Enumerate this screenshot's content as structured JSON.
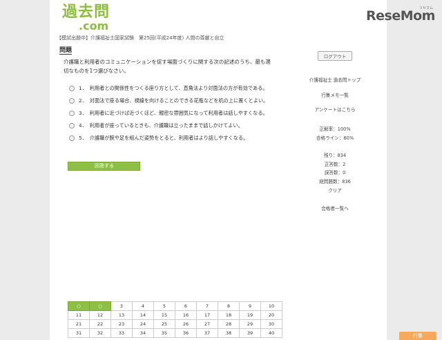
{
  "logo": {
    "main": "過去問",
    "sub": ".com"
  },
  "brand": {
    "name": "ReseMom",
    "ruby": "リセマム"
  },
  "breadcrumb": "【模試出題中】介護福祉士国家試験　第25回(平成24年度) 人間の尊厳と自立",
  "question": {
    "heading": "問題",
    "text": "介護職と利用者のコミュニケーションを促す場面づくりに関する次の記述のうち、最も適切なものを1つ選びなさい。",
    "choices": [
      {
        "num": "1．",
        "text": "利用者との関係性をつくる座り方として、直角法より対面法の方が有効である。"
      },
      {
        "num": "2．",
        "text": "対面法で座る場合、視線を向けることのできる花瓶などを机の上に置くとよい。"
      },
      {
        "num": "3．",
        "text": "利用者に近づけば近づくほど、親密な雰囲気になって利用者は話しやすくなる。"
      },
      {
        "num": "4．",
        "text": "利用者が座っているときも、介護職は立ったままで話しかけてよい。"
      },
      {
        "num": "5．",
        "text": "介護職が腕や足を組んだ姿勢をとると、利用者はより話しやすくなる。"
      }
    ],
    "answer_label": "回答する"
  },
  "sidebar": {
    "logout": "ログアウト",
    "links": [
      "介護福祉士 過去問トップ",
      "行集メモ一覧",
      "アンケートはこちら"
    ],
    "accuracy": "正解率：100%",
    "pass_line": "合格ライン：60%",
    "remaining": "残り：834",
    "correct": "正答数：2",
    "wrong": "誤答数：0",
    "total": "総問題数：836",
    "clear": "クリア",
    "passers": "合格者一覧へ"
  },
  "grid": {
    "rows": [
      [
        "○",
        "○",
        "3",
        "4",
        "5",
        "6",
        "7",
        "8",
        "9",
        "10"
      ],
      [
        "11",
        "12",
        "13",
        "14",
        "15",
        "16",
        "17",
        "18",
        "19",
        "20"
      ],
      [
        "21",
        "22",
        "23",
        "24",
        "25",
        "26",
        "27",
        "28",
        "29",
        "30"
      ],
      [
        "31",
        "32",
        "33",
        "34",
        "35",
        "36",
        "37",
        "38",
        "39",
        "40"
      ]
    ],
    "done_count": 2
  },
  "gyosetsu_button": "行集",
  "colors": {
    "accent": "#8fc046",
    "orange": "#f5a95c"
  }
}
